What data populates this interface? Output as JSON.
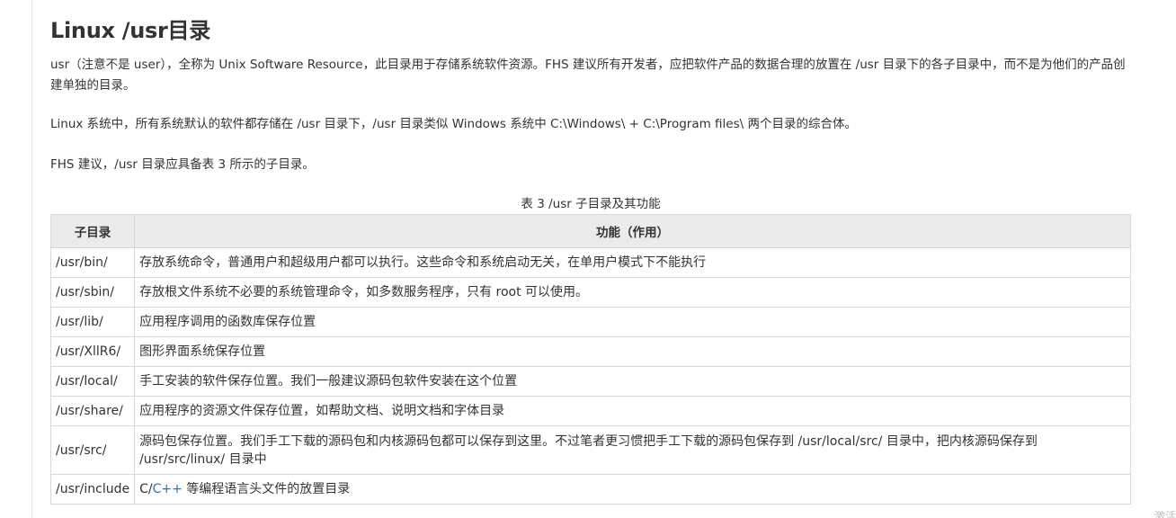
{
  "heading": "Linux /usr目录",
  "paragraphs": [
    "usr（注意不是 user），全称为 Unix Software Resource，此目录用于存储系统软件资源。FHS 建议所有开发者，应把软件产品的数据合理的放置在 /usr 目录下的各子目录中，而不是为他们的产品创建单独的目录。",
    "Linux 系统中，所有系统默认的软件都存储在 /usr 目录下，/usr 目录类似 Windows 系统中 C:\\Windows\\ + C:\\Program files\\ 两个目录的综合体。",
    "FHS 建议，/usr 目录应具备表 3 所示的子目录。"
  ],
  "table": {
    "caption": "表 3 /usr 子目录及其功能",
    "headers": [
      "子目录",
      "功能（作用）"
    ],
    "rows": [
      [
        "/usr/bin/",
        "存放系统命令，普通用户和超级用户都可以执行。这些命令和系统启动无关，在单用户模式下不能执行"
      ],
      [
        "/usr/sbin/",
        "存放根文件系统不必要的系统管理命令，如多数服务程序，只有 root 可以使用。"
      ],
      [
        "/usr/lib/",
        "应用程序调用的函数库保存位置"
      ],
      [
        "/usr/XllR6/",
        "图形界面系统保存位置"
      ],
      [
        "/usr/local/",
        "手工安装的软件保存位置。我们一般建议源码包软件安装在这个位置"
      ],
      [
        "/usr/share/",
        "应用程序的资源文件保存位置，如帮助文档、说明文档和字体目录"
      ],
      [
        "/usr/src/",
        "源码包保存位置。我们手工下载的源码包和内核源码包都可以保存到这里。不过笔者更习惯把手工下载的源码包保存到 /usr/local/src/ 目录中，把内核源码保存到 /usr/src/linux/ 目录中"
      ]
    ],
    "last_row": {
      "dir": "/usr/include",
      "prefix": "C/",
      "link": "C++",
      "suffix": " 等编程语言头文件的放置目录"
    }
  },
  "corner_text": "激活"
}
